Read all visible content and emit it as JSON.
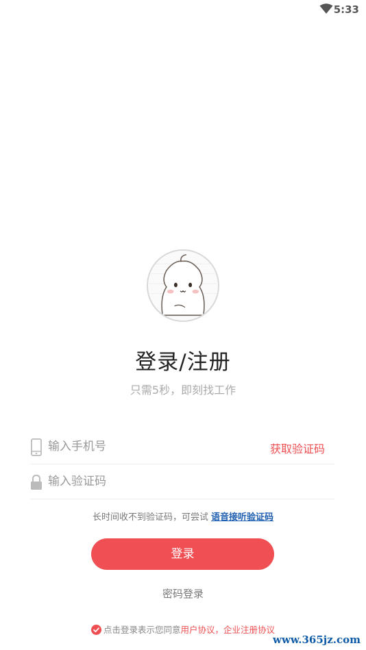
{
  "status_bar": {
    "time": "5:33",
    "wifi_icon": "wifi-icon"
  },
  "header": {
    "avatar_icon": "mascot-avatar",
    "title": "登录/注册",
    "subtitle": "只需5秒，即刻找工作"
  },
  "form": {
    "phone": {
      "icon": "phone-icon",
      "placeholder": "输入手机号",
      "value": ""
    },
    "get_code_label": "获取验证码",
    "code": {
      "icon": "lock-icon",
      "placeholder": "输入验证码",
      "value": ""
    }
  },
  "voice_hint": {
    "text": "长时间收不到验证码，可尝试",
    "link": "语音接听验证码"
  },
  "login_button_label": "登录",
  "password_login_label": "密码登录",
  "agreement": {
    "prefix": "点击登录表示您同意",
    "user_agreement": "用户协议",
    "separator": "，",
    "enterprise_agreement": "企业注册协议",
    "checked": true
  },
  "watermark": "www.365jz.com",
  "colors": {
    "accent": "#f05054",
    "link_blue": "#1f5fb0",
    "watermark": "#0d5aa7"
  }
}
